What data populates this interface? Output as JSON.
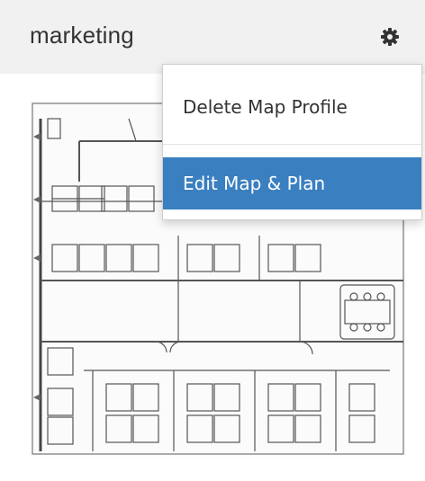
{
  "header": {
    "title": "marketing",
    "settings_icon": "gear-icon"
  },
  "menu": {
    "items": [
      {
        "label": "Delete Map Profile"
      },
      {
        "label": "Edit Map & Plan",
        "active": true,
        "highlight_color": "#3a7fc0"
      }
    ]
  },
  "floorplan": {
    "image": "office floor plan"
  }
}
